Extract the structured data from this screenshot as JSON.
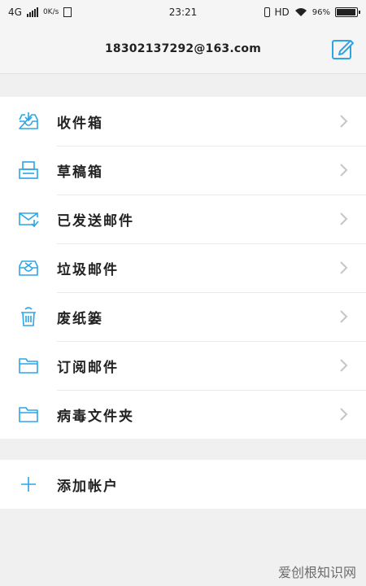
{
  "status_bar": {
    "network": "4G",
    "speed": "0K/s",
    "time": "23:21",
    "hd": "HD",
    "battery": "96%",
    "battery_level": 0.96
  },
  "header": {
    "title": "18302137292@163.com"
  },
  "folders": [
    {
      "label": "收件箱",
      "icon": "inbox-icon"
    },
    {
      "label": "草稿箱",
      "icon": "drafts-icon"
    },
    {
      "label": "已发送邮件",
      "icon": "sent-icon"
    },
    {
      "label": "垃圾邮件",
      "icon": "spam-icon"
    },
    {
      "label": "废纸篓",
      "icon": "trash-icon"
    },
    {
      "label": "订阅邮件",
      "icon": "folder-icon"
    },
    {
      "label": "病毒文件夹",
      "icon": "folder-icon"
    }
  ],
  "add_account": {
    "label": "添加帐户",
    "icon": "plus-icon"
  },
  "watermark": "爱创根知识网",
  "colors": {
    "accent": "#2aa5e6",
    "chevron": "#c5c5c5"
  }
}
